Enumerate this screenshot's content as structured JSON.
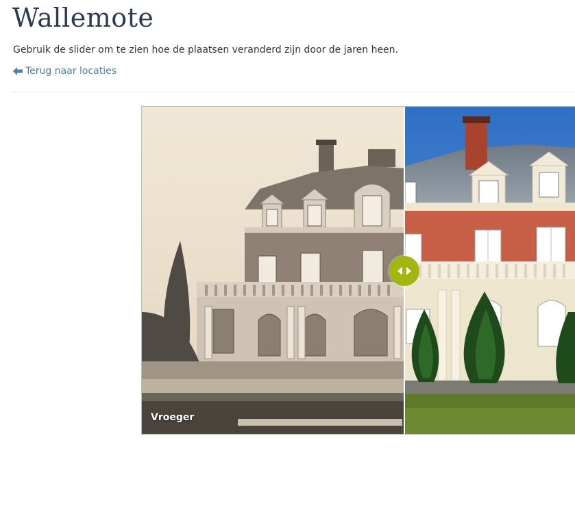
{
  "page": {
    "title": "Wallemote",
    "intro": "Gebruik de slider om te zien hoe de plaatsen veranderd zijn door de jaren heen.",
    "back_link": "Terug naar locaties"
  },
  "comparison": {
    "before_label": "Vroeger",
    "slider_position_fraction": 0.605,
    "handle_icon": "arrows-left-right-icon",
    "accent_color": "#a3b50f",
    "link_color": "#4a7fb3",
    "title_color": "#2c3a55"
  }
}
